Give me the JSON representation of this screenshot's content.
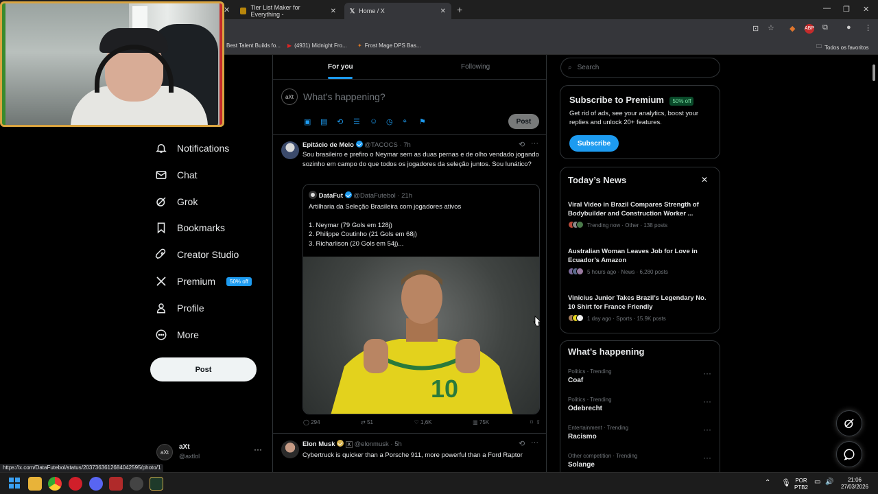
{
  "browser": {
    "tabs": [
      {
        "label": "Tier List Maker for Everything -"
      },
      {
        "label": "Home / X"
      }
    ],
    "bookmarks": [
      "Best Talent Builds fo...",
      "(4931) Midnight Fro...",
      "Frost Mage DPS Bas..."
    ],
    "bookmarks_folder": "Todos os favoritos",
    "status_url": "https://x.com/DataFutebol/status/2037363612684042595/photo/1"
  },
  "nav": {
    "items": [
      {
        "label": "Notifications"
      },
      {
        "label": "Chat"
      },
      {
        "label": "Grok"
      },
      {
        "label": "Bookmarks"
      },
      {
        "label": "Creator Studio"
      },
      {
        "label": "Premium"
      },
      {
        "label": "Profile"
      },
      {
        "label": "More"
      }
    ],
    "premium_badge": "50% off",
    "post_button": "Post",
    "account": {
      "name": "aXt",
      "handle": "@axtlol"
    }
  },
  "timeline": {
    "tabs": [
      "For you",
      "Following"
    ],
    "composer_placeholder": "What’s happening?",
    "composer_post": "Post",
    "tweets": [
      {
        "name": "Epitácio de Melo",
        "handle": "@TACOCS",
        "time": "· 7h",
        "text": "Sou brasileiro e prefiro o Neymar sem as duas pernas e de olho vendado jogando sozinho em campo do que todos os jogadores da seleção juntos. Sou lunático?",
        "quote": {
          "name": "DataFut",
          "handle": "@DataFutebol",
          "time": "· 21h",
          "line1": "Artilharia da Seleção Brasileira com jogadores ativos",
          "item1": "1. Neymar (79 Gols em 128j)",
          "item2": "2. Philippe Coutinho (21 Gols em 68j)",
          "item3": "3. Richarlison (20 Gols em 54j)..."
        },
        "stats": {
          "replies": "294",
          "reposts": "51",
          "likes": "1,6K",
          "views": "75K"
        }
      },
      {
        "name": "Elon Musk",
        "handle": "@elonmusk",
        "time": "· 5h",
        "text": "Cybertruck is quicker than a Porsche 911, more powerful than a Ford Raptor"
      }
    ]
  },
  "sidebar": {
    "search_placeholder": "Search",
    "premium": {
      "title": "Subscribe to Premium",
      "badge": "50% off",
      "text": "Get rid of ads, see your analytics, boost your replies and unlock 20+ features.",
      "button": "Subscribe"
    },
    "news": {
      "title": "Today’s News",
      "items": [
        {
          "title": "Viral Video in Brazil Compares Strength of Bodybuilder and Construction Worker ...",
          "meta": "Trending now · Other · 138 posts"
        },
        {
          "title": "Australian Woman Leaves Job for Love in Ecuador’s Amazon",
          "meta": "5 hours ago · News · 6,280 posts"
        },
        {
          "title": "Vinicius Junior Takes Brazil’s Legendary No. 10 Shirt for France Friendly",
          "meta": "1 day ago · Sports · 15.9K posts"
        }
      ]
    },
    "happening": {
      "title": "What’s happening",
      "items": [
        {
          "category": "Politics · Trending",
          "name": "Coaf"
        },
        {
          "category": "Politics · Trending",
          "name": "Odebrecht"
        },
        {
          "category": "Entertainment · Trending",
          "name": "Racismo"
        },
        {
          "category": "Other competition · Trending",
          "name": "Solange"
        }
      ]
    }
  },
  "taskbar": {
    "lang1": "POR",
    "lang2": "PTB2",
    "time": "21:06",
    "date": "27/03/2026"
  },
  "colors": {
    "accent": "#1d9bf0",
    "background": "#000000",
    "border": "#2f3336",
    "webcam_border": "#d9a441"
  }
}
